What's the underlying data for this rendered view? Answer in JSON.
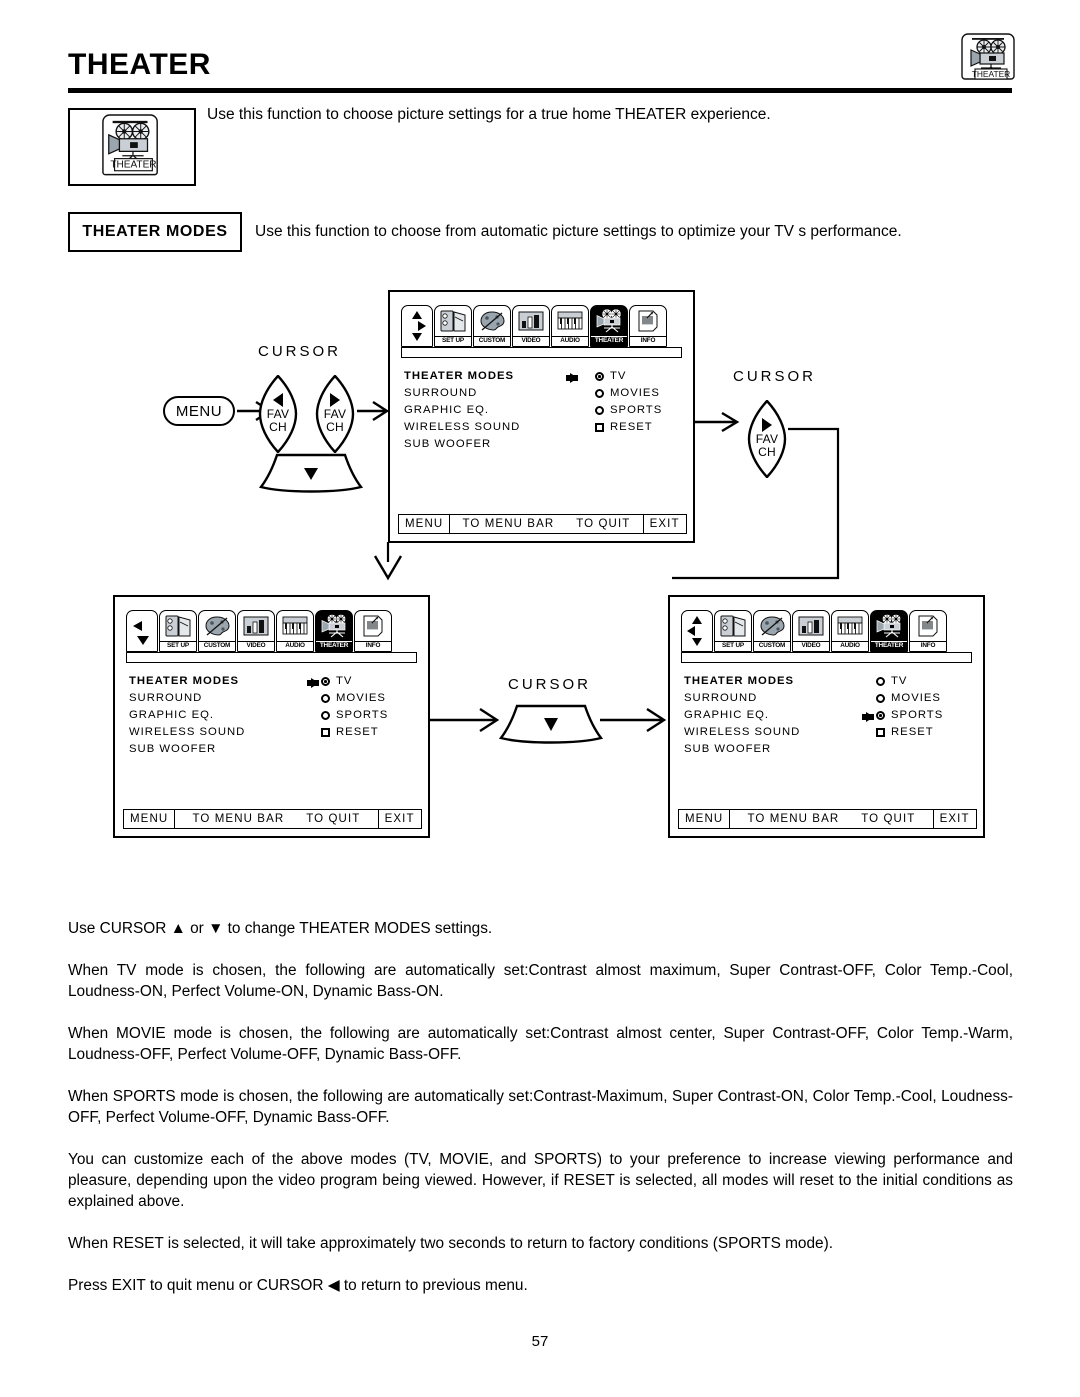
{
  "page": {
    "title": "THEATER",
    "number": "57",
    "intro": "Use this function to choose picture settings for a true home THEATER experience.",
    "section_label": "THEATER MODES",
    "section_text": "Use this function to choose from automatic picture settings to optimize your TV s performance."
  },
  "icons": {
    "theater_badge_label": "THEATER"
  },
  "menubar": {
    "tabs": [
      {
        "label": "",
        "icon": "cursor-pad-icon",
        "active": false
      },
      {
        "label": "SET UP",
        "icon": "setup-icon",
        "active": false
      },
      {
        "label": "CUSTOM",
        "icon": "custom-palette-icon",
        "active": false
      },
      {
        "label": "VIDEO",
        "icon": "video-icon",
        "active": false
      },
      {
        "label": "AUDIO",
        "icon": "audio-keyboard-icon",
        "active": false
      },
      {
        "label": "THEATER",
        "icon": "theater-projector-icon",
        "active": true
      },
      {
        "label": "INFO",
        "icon": "info-document-icon",
        "active": false
      }
    ]
  },
  "osd": {
    "menu_items": [
      "THEATER MODES",
      "SURROUND",
      "GRAPHIC EQ.",
      "WIRELESS SOUND",
      "SUB WOOFER"
    ],
    "options": [
      "TV",
      "MOVIES",
      "SPORTS",
      "RESET"
    ],
    "footer": [
      "MENU",
      "TO MENU BAR",
      "TO QUIT",
      "EXIT"
    ]
  },
  "screens": [
    {
      "id": "screen-top",
      "nav_icon": "cursor-up-right-down-icon",
      "selected_option": "TV",
      "pointer_on": "menu_row_0"
    },
    {
      "id": "screen-bottom-left",
      "nav_icon": "cursor-left-down-icon",
      "selected_option": "TV",
      "pointer_on": "option_row_0"
    },
    {
      "id": "screen-bottom-right",
      "nav_icon": "cursor-left-up-down-icon",
      "selected_option": "SPORTS",
      "pointer_on": "option_row_2"
    }
  ],
  "remote": {
    "cursor_label": "CURSOR",
    "menu_label": "MENU",
    "favch_label_line1": "FAV",
    "favch_label_line2": "CH"
  },
  "body": {
    "paragraphs": [
      "Use CURSOR ▲ or ▼ to change THEATER MODES settings.",
      "When TV mode is chosen, the following are automatically set:Contrast almost maximum, Super Contrast-OFF, Color Temp.-Cool, Loudness-ON, Perfect Volume-ON, Dynamic Bass-ON.",
      "When MOVIE mode is chosen, the following are automatically set:Contrast almost center, Super Contrast-OFF, Color Temp.-Warm, Loudness-OFF, Perfect Volume-OFF, Dynamic Bass-OFF.",
      "When SPORTS mode is chosen, the following are automatically set:Contrast-Maximum, Super Contrast-ON, Color Temp.-Cool, Loudness-OFF, Perfect Volume-OFF, Dynamic Bass-OFF.",
      "You can customize each of the above modes (TV, MOVIE, and SPORTS) to your preference to increase viewing performance and pleasure, depending upon the video program being viewed. However, if RESET is selected, all modes will reset to the initial conditions as explained above.",
      "When RESET is selected, it will take approximately two seconds to return to factory conditions (SPORTS mode).",
      "Press EXIT to quit menu or CURSOR ◀ to return to previous menu."
    ]
  },
  "colors": {
    "ink": "#000000",
    "paper": "#ffffff",
    "icon_gray": "#c9cfd4",
    "icon_dark": "#6f7a83"
  }
}
